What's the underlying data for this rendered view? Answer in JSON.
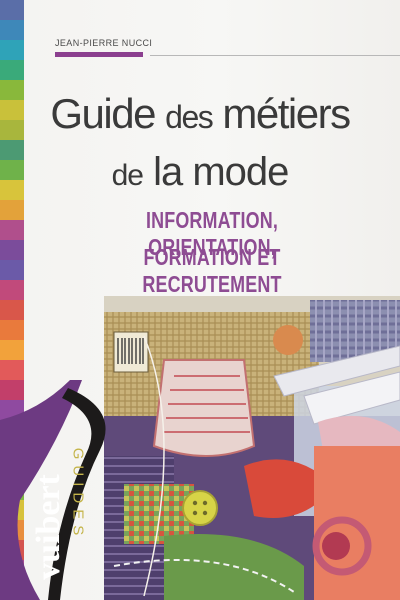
{
  "author": "JEAN-PIERRE NUCCI",
  "title": {
    "line1_word1": "Guide",
    "line1_word2": "des",
    "line1_word3": "métiers",
    "line2_word1": "de",
    "line2_word2": "la mode"
  },
  "subtitle": {
    "line1": "INFORMATION, ORIENTATION,",
    "line2": "FORMATION ET RECRUTEMENT"
  },
  "publisher": "vuibert",
  "series": "GUIDES",
  "colors": {
    "accent_purple": "#8e4c93",
    "series_purple": "#6d3a82",
    "title_gray": "#3a3a3a"
  },
  "spine_colors": [
    "#5a6ea8",
    "#3e88b9",
    "#2fa3b8",
    "#3aaa7a",
    "#89b83b",
    "#c9c13a",
    "#a8b63d",
    "#4c9a73",
    "#6fb24a",
    "#d8c43b",
    "#e3a23a",
    "#b04f8c",
    "#7b4c9b",
    "#6b5aa8",
    "#c14a7b",
    "#d9574a",
    "#e97a3c",
    "#f2a23b",
    "#e25a5a",
    "#c23f6a",
    "#8f4aa0",
    "#5e6fb3",
    "#3f8fc0",
    "#35a58a",
    "#7eb845",
    "#d7c23c",
    "#e88e3e",
    "#d4544f",
    "#a44a91",
    "#6e58a6"
  ]
}
